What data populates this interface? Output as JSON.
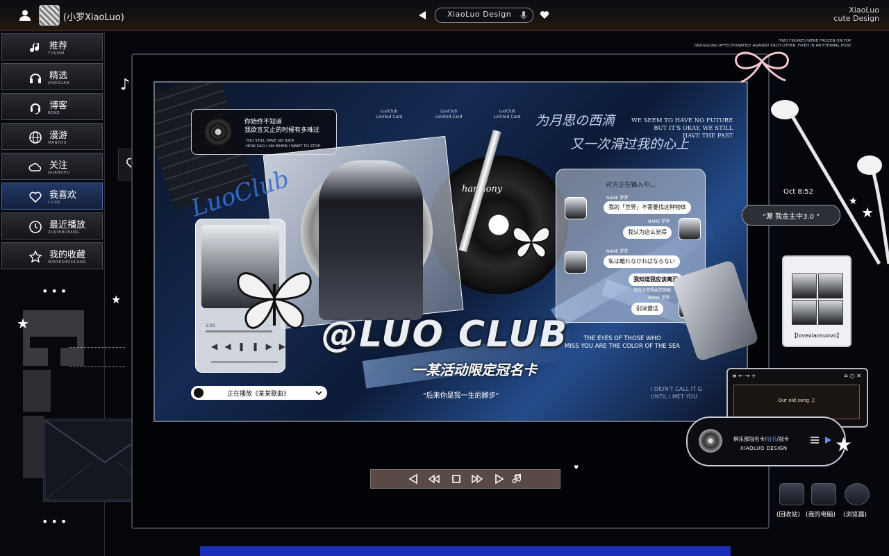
{
  "header": {
    "username": "(小罗XiaoLuo)",
    "center_title": "XiaoLuo Design",
    "brand_line1": "XiaoLuo",
    "brand_line2": "cute Design"
  },
  "sidebar": {
    "items": [
      {
        "label": "推荐",
        "sub": "TUIJIAN",
        "icon": "music-note-icon"
      },
      {
        "label": "精选",
        "sub": "JINGXUAN",
        "icon": "headphones-icon"
      },
      {
        "label": "博客",
        "sub": "BOKE",
        "icon": "headset-icon"
      },
      {
        "label": "漫游",
        "sub": "MANYOU",
        "icon": "globe-icon"
      },
      {
        "label": "关注",
        "sub": "GUANZHU",
        "icon": "cloud-icon"
      },
      {
        "label": "我喜欢",
        "sub": "I LIKE",
        "icon": "heart-icon"
      },
      {
        "label": "最近播放",
        "sub": "ZUIJINBOFANG",
        "icon": "clock-icon"
      },
      {
        "label": "我的收藏",
        "sub": "WODESHOUCANG",
        "icon": "star-icon"
      }
    ],
    "dots": "•••"
  },
  "poster": {
    "quote_zh1": "你始终不知道",
    "quote_zh2": "我欲言又止的时候有多难过",
    "quote_en1": "YOU STILL HAVE NO IDEA",
    "quote_en2": "HOW SAD I AM WHEN I WANT TO STOP",
    "card_labels": [
      "LuoClub",
      "LuoClub",
      "LuoClub"
    ],
    "card_sub": "Limited Card",
    "hand_line1": "为月思の西滴",
    "hand_line2": "又一次滑过我的心上",
    "future_text_1": "WE SEEM TO HAVE NO FUTURE",
    "future_text_2": "BUT IT'S OKAY, WE STILL",
    "future_text_3": "HAVE THE PAST",
    "vinyl_label": "harmony",
    "luo_script": "LuoClub",
    "chat_title": "对方正在输入中...",
    "chat_names": [
      "NAME 罗罗",
      "NAME 罗罗",
      "NAME 罗罗",
      "NAME 罗罗"
    ],
    "chat_messages": [
      "我的「世界」不需要找这种物体",
      "我认为这么觉得",
      "私は離れなければならない",
      "我知道我应该离开",
      "但我总觉得会伤到他",
      "别说傻话"
    ],
    "main_title": "@LUO CLUB",
    "sub_title": "一某活动限定冠名卡",
    "main_quote": "\"后来你是我一生的脚步\"",
    "eyes_1": "THE EYES OF THOSE WHO",
    "eyes_2": "MISS YOU ARE THE COLOR OF THE SEA",
    "br_text_1": "I DIDN'T CALL IT G",
    "br_text_2": "UNTIL I MET YOU",
    "now_playing": "正在播放《某某歌曲》",
    "player_time_left": "1:03",
    "player_time_right": "-"
  },
  "right_panel": {
    "top_tiny_1": "TWO FIGURES WERE FROZEN ON TOP",
    "top_tiny_2": "SNUGGLING AFFECTIONATELY AGAINST EACH OTHER, FIXED IN AN ETERNAL POSE",
    "clock": "Oct 8:52",
    "notice": "\"源 我金主中3.0 \"",
    "badge_text": "【lovexiaosuovo】",
    "mini_win_nav": "≡ ← → +",
    "mini_win_ctrl": "≐ ○ ✕",
    "mini_song": "Our old song ♫",
    "music_title_a": "俱乐部冠名卡/",
    "music_title_b": "冠名",
    "music_title_c": "/冠卡",
    "music_sub": "XIAOLUO DESIGN",
    "desktop_icons": [
      {
        "label": "(回收站)",
        "icon": "recycle-bin-icon"
      },
      {
        "label": "(我的电脑)",
        "icon": "computer-icon"
      },
      {
        "label": "(浏览器)",
        "icon": "browser-icon"
      }
    ]
  },
  "colors": {
    "accent_blue": "#2a4f9c",
    "active_side": "#243a66",
    "bottom_bar": "#1a2fb8"
  }
}
